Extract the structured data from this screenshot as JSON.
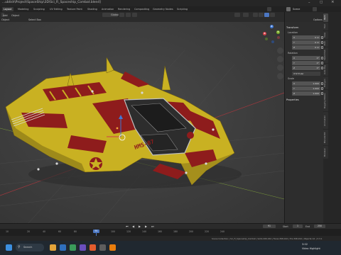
{
  "window": {
    "title": "...ublish\\Project\\SpaceShip\\3D\\Sci_Fi_Spaceship_Combat.blend]"
  },
  "menu": {
    "workspaces": [
      "Layout",
      "Modeling",
      "Sculpting",
      "UV Editing",
      "Texture Paint",
      "Shading",
      "Animation",
      "Rendering",
      "Compositing",
      "Geometry Nodes",
      "Scripting"
    ],
    "scene": "Scene"
  },
  "header": {
    "view_mode": "Object",
    "add": "Add",
    "object": "Object",
    "select_box": "Select Box",
    "transform": "Global",
    "options": "Options"
  },
  "viewport": {
    "hull_text": "HMS-07",
    "gizmo": {
      "x": "X",
      "y": "Y",
      "z": "Z"
    }
  },
  "npanel": {
    "transform_title": "Transform",
    "location_label": "Location",
    "location": [
      {
        "axis": "X",
        "value": "0 m"
      },
      {
        "axis": "Y",
        "value": "0 m"
      },
      {
        "axis": "Z",
        "value": "0 m"
      }
    ],
    "rotation_label": "Rotation",
    "rotation": [
      {
        "axis": "X",
        "value": "0°"
      },
      {
        "axis": "Y",
        "value": "0°"
      },
      {
        "axis": "Z",
        "value": "0°"
      }
    ],
    "mode": "XYZ Euler",
    "scale_label": "Scale",
    "scale": [
      {
        "axis": "X",
        "value": "1.000"
      },
      {
        "axis": "Y",
        "value": "1.000"
      },
      {
        "axis": "Z",
        "value": "1.000"
      }
    ],
    "properties_title": "Properties"
  },
  "sidebar_tabs": [
    "Item",
    "Tool",
    "View",
    "Edit",
    "Sketchfab",
    "Auto Rig",
    "Poliigon",
    "Rigging Nodes",
    "Animation",
    "BlenderKit",
    "Boolean"
  ],
  "timeline": {
    "current_frame": "91",
    "start_label": "Start",
    "start": "1",
    "end_label": "End",
    "end": "250",
    "frame_field": "91",
    "ticks": [
      "0",
      "10",
      "30",
      "50",
      "70",
      "90",
      "110",
      "130",
      "150",
      "170",
      "190",
      "210",
      "230",
      "250"
    ],
    "ruler_ticks": [
      "10",
      "20",
      "40",
      "60",
      "80",
      "100",
      "120",
      "140",
      "160",
      "180",
      "200",
      "220",
      "240"
    ]
  },
  "statusbar": {
    "info": "Scene Collection | Sci_Fi_Spaceship_Combat | Verts:206,164 | Faces:398,194 | Tris:398,194 | Objects:1/1 | 3.3.1"
  },
  "taskbar": {
    "search": "Search",
    "notification": "Video Highlight",
    "time": "3:02"
  },
  "colors": {
    "accent": "#4c77c2",
    "hull_yellow": "#c9b122",
    "hull_red": "#8e1c1c",
    "axis_x": "#d43e47",
    "axis_y": "#7fb329",
    "axis_z": "#3e78d6"
  }
}
